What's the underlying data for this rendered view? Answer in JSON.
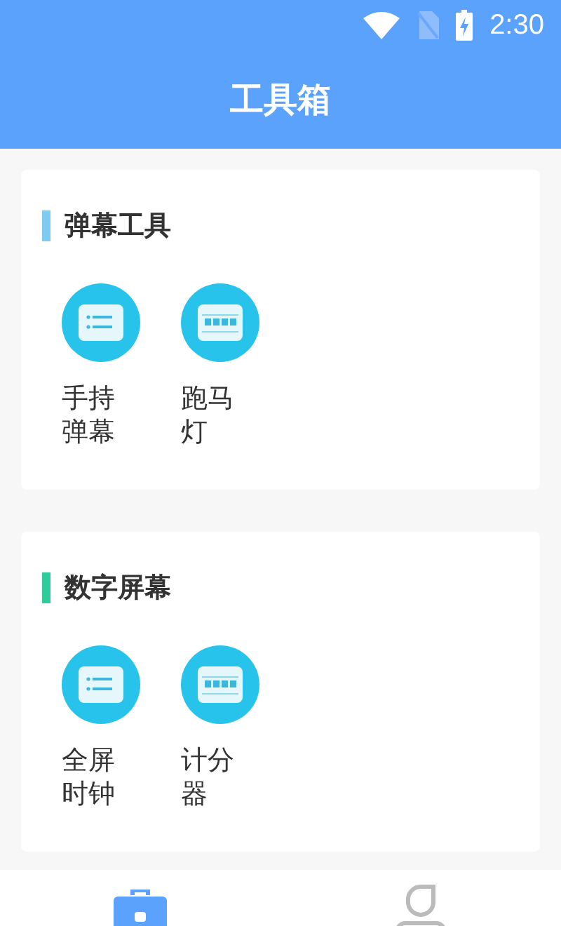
{
  "status_bar": {
    "time": "2:30"
  },
  "app_bar": {
    "title": "工具箱"
  },
  "sections": [
    {
      "title": "弹幕工具",
      "color": "#7ecbf0",
      "items": [
        {
          "label": "手持弹幕",
          "kind": "list"
        },
        {
          "label": "跑马灯",
          "kind": "marquee"
        }
      ]
    },
    {
      "title": "数字屏幕",
      "color": "#2ecc9a",
      "items": [
        {
          "label": "全屏时钟",
          "kind": "list"
        },
        {
          "label": "计分器",
          "kind": "marquee"
        }
      ]
    }
  ],
  "nav": [
    {
      "kind": "toolbox",
      "selected": true
    },
    {
      "kind": "person",
      "selected": false
    }
  ]
}
